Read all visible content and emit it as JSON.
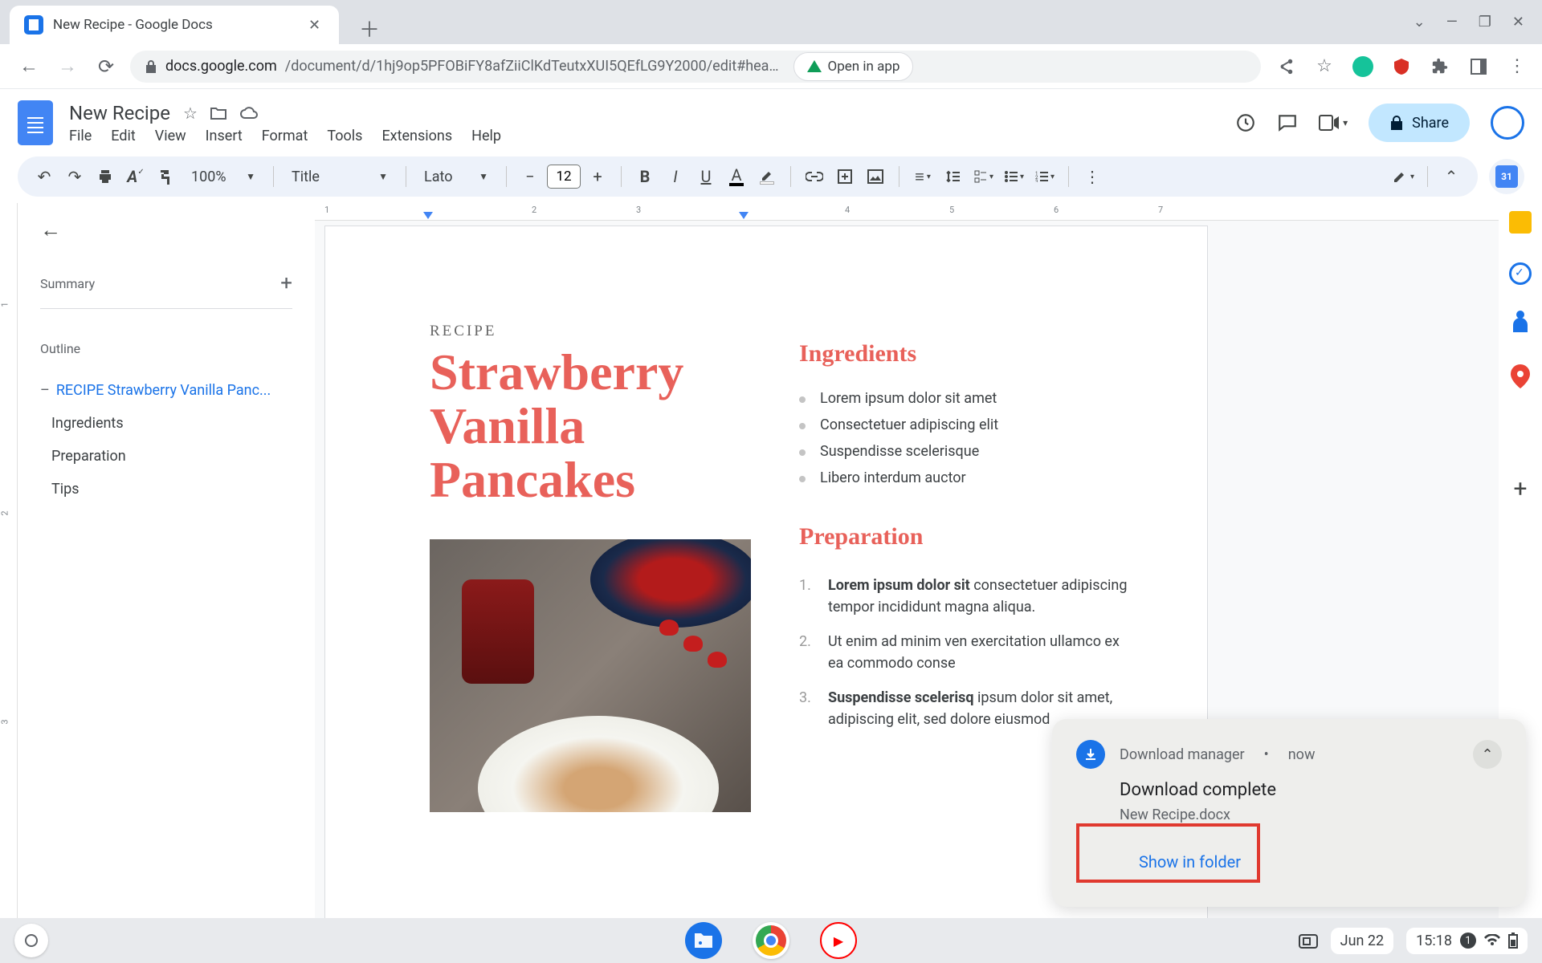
{
  "browser": {
    "tab_title": "New Recipe - Google Docs",
    "url_host": "docs.google.com",
    "url_path": "/document/d/1hj9op5PFOBiFY8afZiiClKdTeutxXUI5QEfLG9Y2000/edit#hea…",
    "open_in_app": "Open in app"
  },
  "doc": {
    "title": "New Recipe",
    "menus": [
      "File",
      "Edit",
      "View",
      "Insert",
      "Format",
      "Tools",
      "Extensions",
      "Help"
    ],
    "share_label": "Share"
  },
  "toolbar": {
    "zoom": "100%",
    "style": "Title",
    "font": "Lato",
    "font_size": "12"
  },
  "outline": {
    "summary_label": "Summary",
    "outline_label": "Outline",
    "items": [
      {
        "label": "RECIPE Strawberry Vanilla Panc...",
        "active": true
      },
      {
        "label": "Ingredients",
        "active": false
      },
      {
        "label": "Preparation",
        "active": false
      },
      {
        "label": "Tips",
        "active": false
      }
    ]
  },
  "page": {
    "kicker": "RECIPE",
    "title": "Strawberry Vanilla Pancakes",
    "ingredients_heading": "Ingredients",
    "ingredients": [
      "Lorem ipsum dolor sit amet",
      "Consectetuer adipiscing elit",
      "Suspendisse scelerisque",
      "Libero interdum auctor"
    ],
    "preparation_heading": "Preparation",
    "preparation": [
      {
        "bold": "Lorem ipsum dolor sit",
        "rest": " consectetuer adipiscing tempor incididunt magna aliqua."
      },
      {
        "bold": "",
        "rest": "Ut enim ad minim ven exercitation ullamco ex ea commodo conse"
      },
      {
        "bold": "Suspendisse scelerisq",
        "rest": " ipsum dolor sit amet, adipiscing elit, sed dolore eiusmod"
      }
    ]
  },
  "toast": {
    "source": "Download manager",
    "when": "now",
    "title": "Download complete",
    "filename": "New Recipe.docx",
    "action": "Show in folder"
  },
  "shelf": {
    "date": "Jun 22",
    "time": "15:18",
    "notif_count": "1"
  },
  "ruler_h": [
    "1",
    "2",
    "3",
    "4",
    "5",
    "6",
    "7"
  ],
  "ruler_v": [
    "1",
    "2",
    "3"
  ]
}
